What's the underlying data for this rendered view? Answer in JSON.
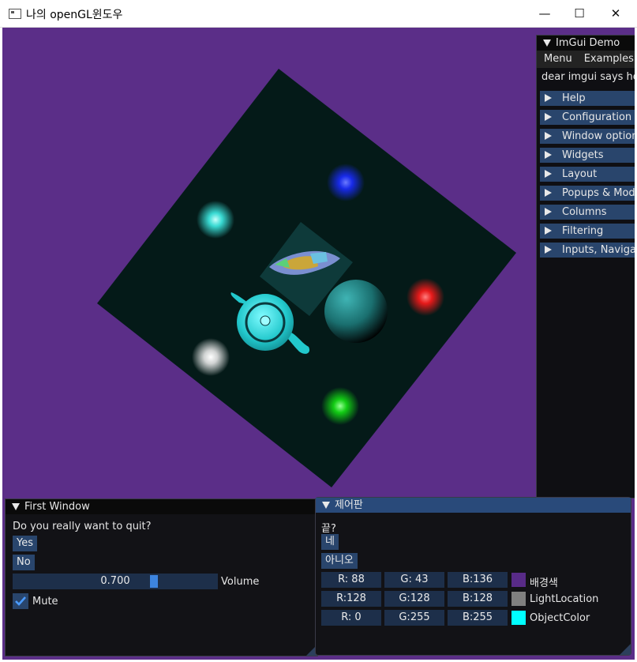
{
  "window": {
    "title": "나의 openGL윈도우",
    "minimize_glyph": "—",
    "maximize_glyph": "☐",
    "close_glyph": "✕"
  },
  "colors": {
    "background": "#5b2e88",
    "floor": "#041a18",
    "teapot": "#2fd3d3",
    "sphere": "#1f8e8e",
    "light_cyan": "#3ff0e8",
    "light_blue": "#1a2cff",
    "light_red": "#ff1a1a",
    "light_white": "#ffffff",
    "light_green": "#14e014"
  },
  "demo": {
    "title": "ImGui Demo",
    "menus": [
      "Menu",
      "Examples"
    ],
    "message": "dear imgui says hello",
    "headers": [
      "Help",
      "Configuration",
      "Window options",
      "Widgets",
      "Layout",
      "Popups & Modal",
      "Columns",
      "Filtering",
      "Inputs, Navigatio"
    ]
  },
  "first_window": {
    "title": "First Window",
    "question": "Do you really want to quit?",
    "yes": "Yes",
    "no": "No",
    "slider_value": "0.700",
    "volume": 0.7,
    "volume_label": "Volume",
    "mute_label": "Mute",
    "mute_checked": true
  },
  "control_panel": {
    "title": "제어판",
    "end_label": "끝?",
    "yes_button": "네",
    "no_button": "아니오",
    "rows": [
      {
        "r": "R: 88",
        "g": "G: 43",
        "b": "B:136",
        "label": "배경색",
        "color": "#582b88"
      },
      {
        "r": "R:128",
        "g": "G:128",
        "b": "B:128",
        "label": "LightLocation",
        "color": "#808080"
      },
      {
        "r": "R:  0",
        "g": "G:255",
        "b": "B:255",
        "label": "ObjectColor",
        "color": "#00ffff"
      }
    ]
  }
}
